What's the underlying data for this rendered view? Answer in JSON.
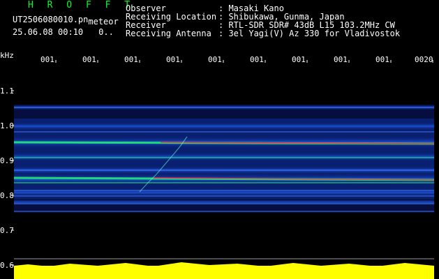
{
  "header": {
    "brand": "H R O F F T",
    "filename": "UT2506080010.pn",
    "filename_suffix": "meteor",
    "timestamp": "25.06.08 00:10",
    "marker": "0..",
    "rows": [
      {
        "label": "Observer",
        "value": ": Masaki Kano"
      },
      {
        "label": "Receiving Location",
        "value": ": Shibukawa, Gunma, Japan"
      },
      {
        "label": "Receiver",
        "value": ": RTL-SDR SDR# 43dB L15 103.2MHz CW"
      },
      {
        "label": "Receiving Antenna",
        "value": ": 3el Yagi(V) Az 330 for Vladivostok"
      }
    ]
  },
  "axis": {
    "unit": "kHz",
    "x_ticks": [
      "001",
      "001",
      "001",
      "001",
      "001",
      "001",
      "001",
      "001",
      "001",
      "0020"
    ],
    "y_ticks": [
      "1.1",
      "1.0",
      "0.9",
      "0.8",
      "0.7",
      "0.6"
    ]
  },
  "colors": {
    "background": "#000000",
    "brand": "#00ff2a",
    "text": "#ffffff",
    "strong_signal": "#ff2244",
    "mid_signal": "#22ff66",
    "weak_signal": "#1a66ff",
    "level_bar": "#ffff00"
  }
}
